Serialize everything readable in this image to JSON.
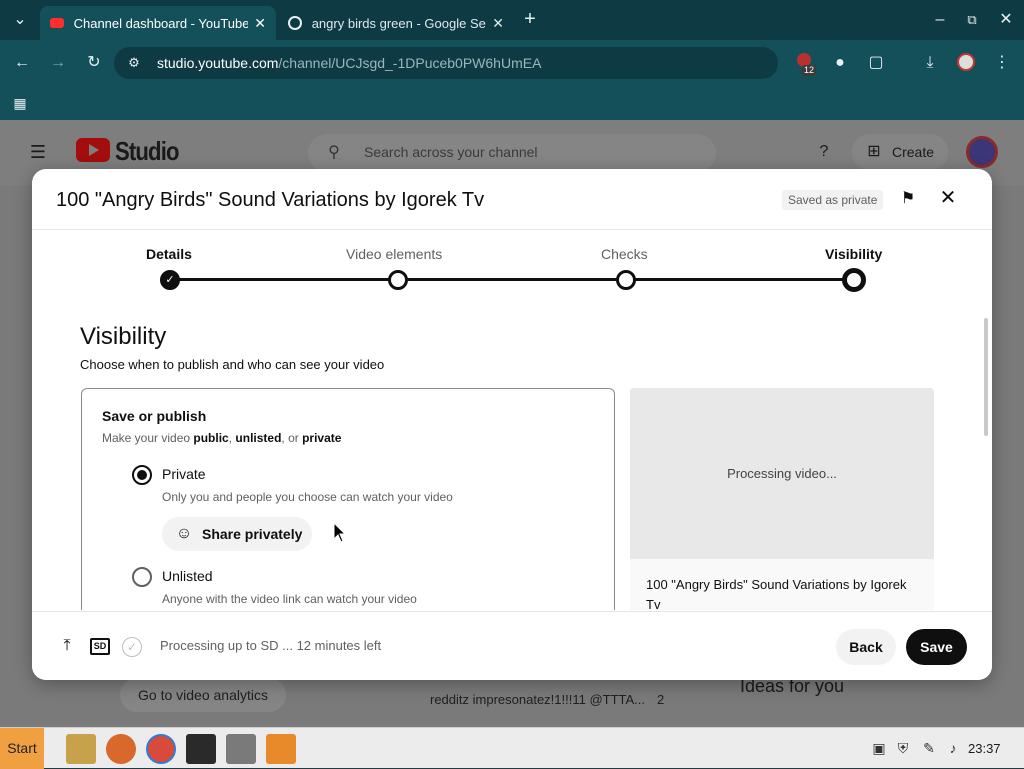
{
  "browser": {
    "tabs": [
      {
        "title": "Channel dashboard - YouTube",
        "active": true
      },
      {
        "title": "angry birds green - Google Search",
        "active": false
      }
    ],
    "new_tab_glyph": "+",
    "url_host": "studio.youtube.com",
    "url_path": "/channel/UCJsgd_-1DPuceb0PW6hUmEA",
    "extension_badge": "12"
  },
  "studio": {
    "logo_text": "Studio",
    "search_placeholder": "Search across your channel",
    "create_label": "Create",
    "analytics_button": "Go to video analytics",
    "comment_snippet": "redditz impresonatez!1!!!11 @TTTA...",
    "comment_count": "2",
    "ideas_heading": "Ideas for you"
  },
  "dialog": {
    "title": "100 \"Angry Birds\" Sound Variations by Igorek Tv",
    "saved_badge": "Saved as private",
    "steps": [
      "Details",
      "Video elements",
      "Checks",
      "Visibility"
    ],
    "heading": "Visibility",
    "subheading": "Choose when to publish and who can see your video",
    "box_title": "Save or publish",
    "box_sub_prefix": "Make your video ",
    "box_sub_public": "public",
    "box_sub_sep": ", ",
    "box_sub_unlisted": "unlisted",
    "box_sub_or": ", or ",
    "box_sub_private": "private",
    "options": [
      {
        "label": "Private",
        "desc": "Only you and people you choose can watch your video",
        "selected": true
      },
      {
        "label": "Unlisted",
        "desc": "Anyone with the video link can watch your video",
        "selected": false
      }
    ],
    "share_button": "Share privately",
    "preview_processing": "Processing video...",
    "preview_title": "100 \"Angry Birds\" Sound Variations by Igorek Tv",
    "footer_sd": "SD",
    "footer_status": "Processing up to SD ... 12 minutes left",
    "back_label": "Back",
    "save_label": "Save"
  },
  "taskbar": {
    "start_label": "Start",
    "clock": "23:37"
  },
  "colors": {
    "browser_frame": "#0e3a44",
    "toolbar": "#14505a",
    "save_button": "#0f0f0f",
    "taskbar_start": "#f0a040"
  }
}
